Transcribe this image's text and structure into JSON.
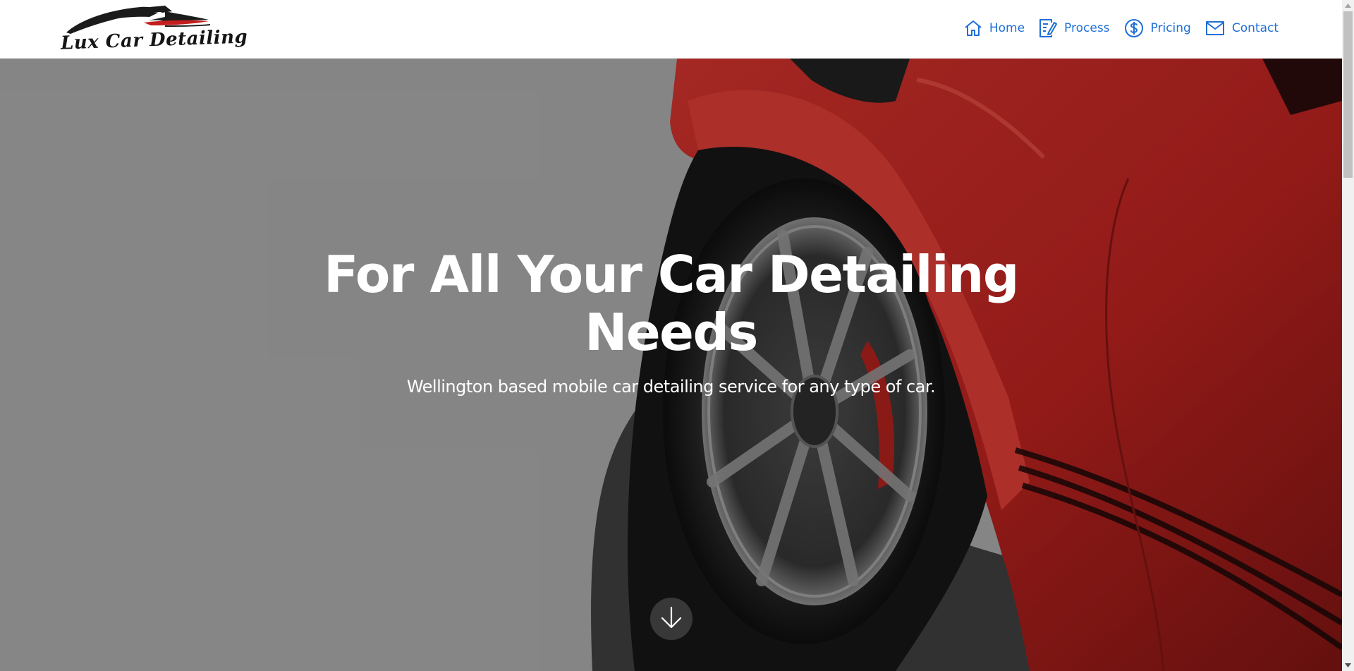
{
  "brand": {
    "logo_text": "Lux Car Detailing"
  },
  "nav": {
    "items": [
      {
        "label": "Home",
        "icon": "home-icon"
      },
      {
        "label": "Process",
        "icon": "edit-document-icon"
      },
      {
        "label": "Pricing",
        "icon": "dollar-circle-icon"
      },
      {
        "label": "Contact",
        "icon": "mail-icon"
      }
    ]
  },
  "hero": {
    "title_line1": "For All Your Car Detailing",
    "title_line2": "Needs",
    "subtitle": "Wellington based mobile car detailing service for any type of car.",
    "scroll_icon": "arrow-down-icon"
  },
  "colors": {
    "accent": "#1f6fd6",
    "hero_bg": "#a3a3a3",
    "car_red": "#b8221f"
  }
}
